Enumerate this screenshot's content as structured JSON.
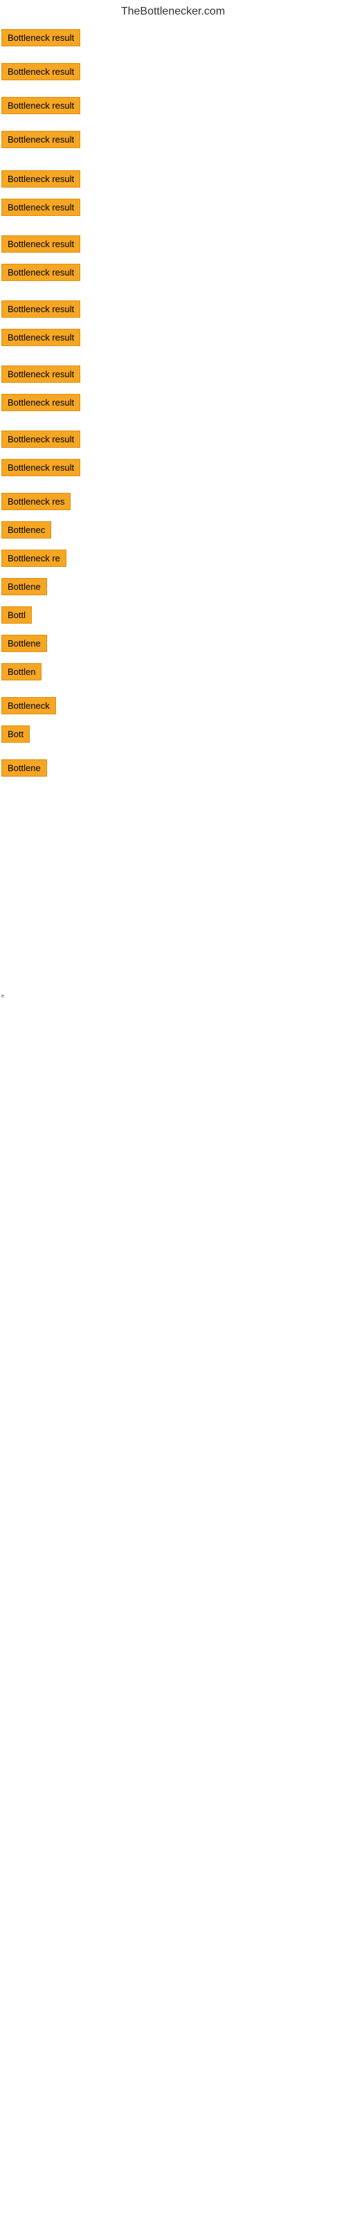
{
  "site": {
    "title": "TheBottlenecker.com"
  },
  "rows": [
    {
      "id": 1,
      "label": "Bottleneck result",
      "width": "full",
      "top_gap": 8
    },
    {
      "id": 2,
      "label": "Bottleneck result",
      "width": "full",
      "top_gap": 16
    },
    {
      "id": 3,
      "label": "Bottleneck result",
      "width": "full",
      "top_gap": 16
    },
    {
      "id": 4,
      "label": "Bottleneck result",
      "width": "full",
      "top_gap": 16
    },
    {
      "id": 5,
      "label": "Bottleneck result",
      "width": "full",
      "top_gap": 24
    },
    {
      "id": 6,
      "label": "Bottleneck result",
      "width": "full",
      "top_gap": 8
    },
    {
      "id": 7,
      "label": "Bottleneck result",
      "width": "full",
      "top_gap": 20
    },
    {
      "id": 8,
      "label": "Bottleneck result",
      "width": "full",
      "top_gap": 8
    },
    {
      "id": 9,
      "label": "Bottleneck result",
      "width": "full",
      "top_gap": 20
    },
    {
      "id": 10,
      "label": "Bottleneck result",
      "width": "full",
      "top_gap": 8
    },
    {
      "id": 11,
      "label": "Bottleneck result",
      "width": "full",
      "top_gap": 20
    },
    {
      "id": 12,
      "label": "Bottleneck result",
      "width": "full",
      "top_gap": 8
    },
    {
      "id": 13,
      "label": "Bottleneck result",
      "width": "full",
      "top_gap": 20
    },
    {
      "id": 14,
      "label": "Bottleneck result",
      "width": "full",
      "top_gap": 8
    },
    {
      "id": 15,
      "label": "Bottleneck res",
      "width": "partial1",
      "top_gap": 16
    },
    {
      "id": 16,
      "label": "Bottlenec",
      "width": "partial2",
      "top_gap": 8
    },
    {
      "id": 17,
      "label": "Bottleneck re",
      "width": "partial3",
      "top_gap": 8
    },
    {
      "id": 18,
      "label": "Bottlene",
      "width": "partial4",
      "top_gap": 8
    },
    {
      "id": 19,
      "label": "Bottl",
      "width": "partial5",
      "top_gap": 8
    },
    {
      "id": 20,
      "label": "Bottlene",
      "width": "partial4",
      "top_gap": 8
    },
    {
      "id": 21,
      "label": "Bottlen",
      "width": "partial6",
      "top_gap": 8
    },
    {
      "id": 22,
      "label": "Bottleneck",
      "width": "partial7",
      "top_gap": 16
    },
    {
      "id": 23,
      "label": "Bott",
      "width": "partial8",
      "top_gap": 8
    },
    {
      "id": 24,
      "label": "Bottlene",
      "width": "partial4",
      "top_gap": 16
    }
  ],
  "bottom_label": "e",
  "colors": {
    "badge_bg": "#f5a623",
    "badge_border": "#e09010",
    "badge_text": "#000000",
    "title_text": "#333333",
    "bg": "#ffffff"
  }
}
